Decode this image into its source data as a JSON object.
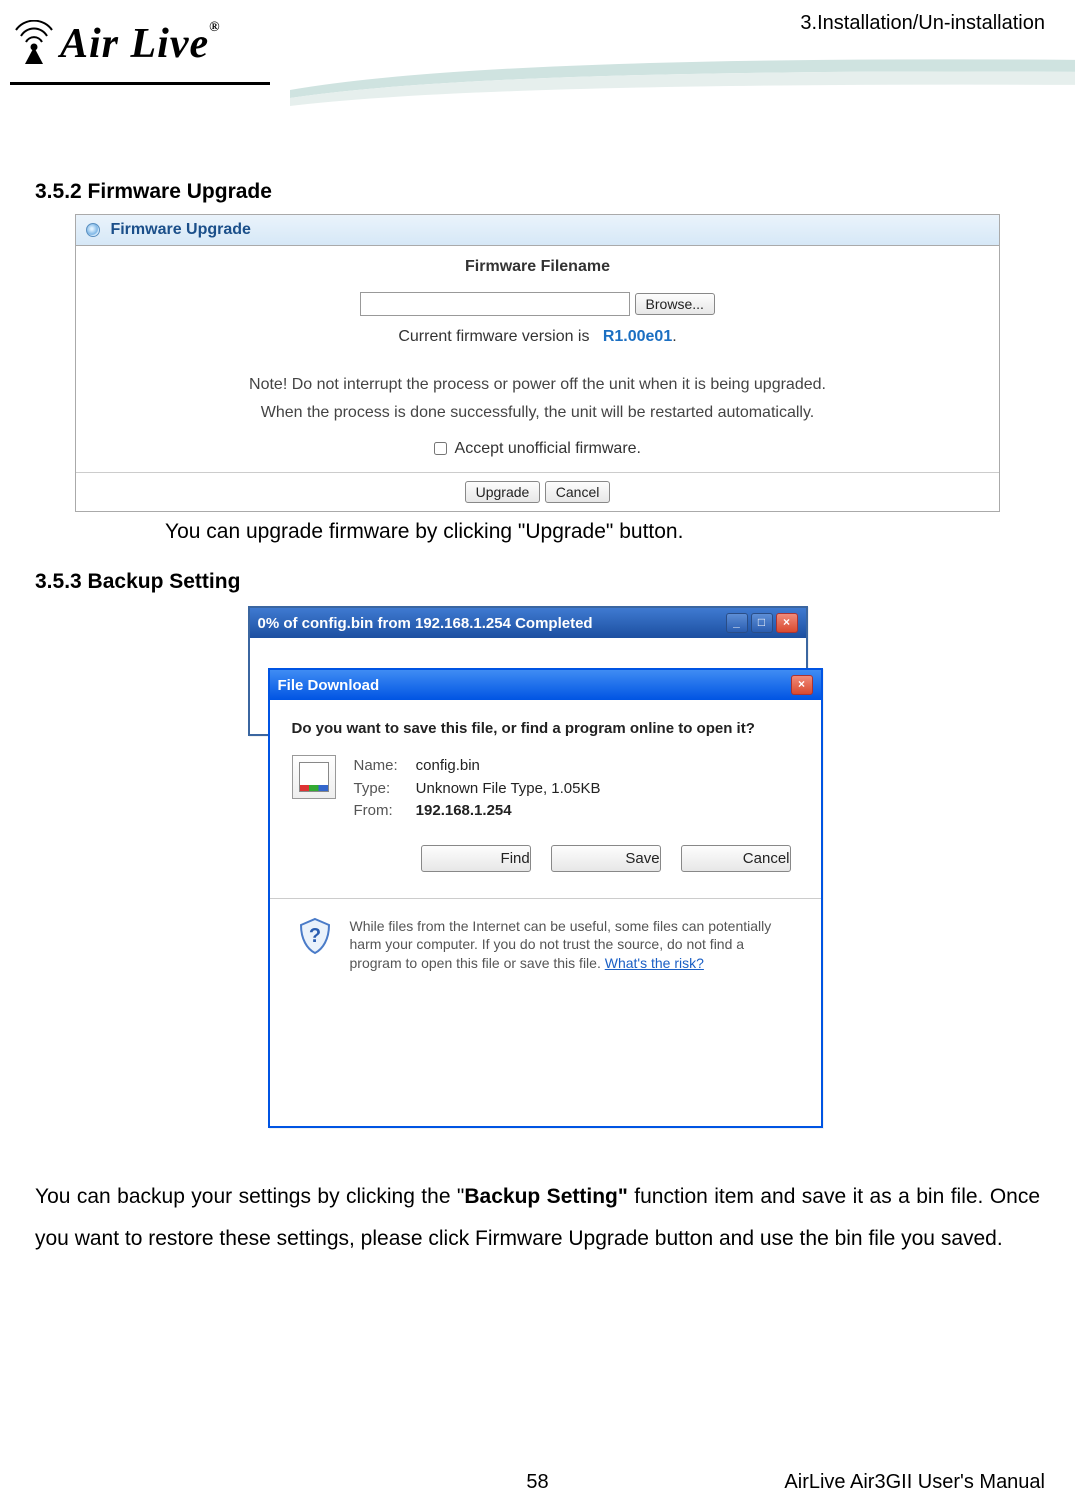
{
  "page": {
    "header_right": "3.Installation/Un-installation",
    "logo_text": "Air Live",
    "logo_reg": "®",
    "number": "58",
    "manual": "AirLive Air3GII User's Manual"
  },
  "s352": {
    "heading": "3.5.2 Firmware Upgrade",
    "panel_title": "Firmware Upgrade",
    "filename_label": "Firmware Filename",
    "browse": "Browse...",
    "version_prefix": "Current firmware version is",
    "version": "R1.00e01",
    "version_suffix": ".",
    "note1": "Note! Do not interrupt the process or power off the unit when it is being upgraded.",
    "note2": "When the process is done successfully, the unit will be restarted automatically.",
    "accept_label": "Accept unofficial firmware.",
    "upgrade_btn": "Upgrade",
    "cancel_btn": "Cancel",
    "caption": "You can upgrade firmware by clicking \"Upgrade\" button."
  },
  "s353": {
    "heading": "3.5.3 Backup Setting",
    "progress_title": "0% of config.bin from 192.168.1.254 Completed",
    "dialog_title": "File Download",
    "question": "Do you want to save this file, or find a program online to open it?",
    "name_k": "Name:",
    "name_v": "config.bin",
    "type_k": "Type:",
    "type_v": "Unknown File Type, 1.05KB",
    "from_k": "From:",
    "from_v": "192.168.1.254",
    "find_btn": "Find",
    "save_btn": "Save",
    "cancel_btn": "Cancel",
    "warn_text": "While files from the Internet can be useful, some files can potentially harm your computer. If you do not trust the source, do not find a program to open this file or save this file. ",
    "risk_link": "What's the risk?",
    "para_before": "You can backup your settings by clicking the \"",
    "para_bold": "Backup Setting\"",
    "para_after": " function item and save it as a bin file. Once you want to restore these settings, please click Firmware Upgrade button and use the bin file you saved."
  }
}
